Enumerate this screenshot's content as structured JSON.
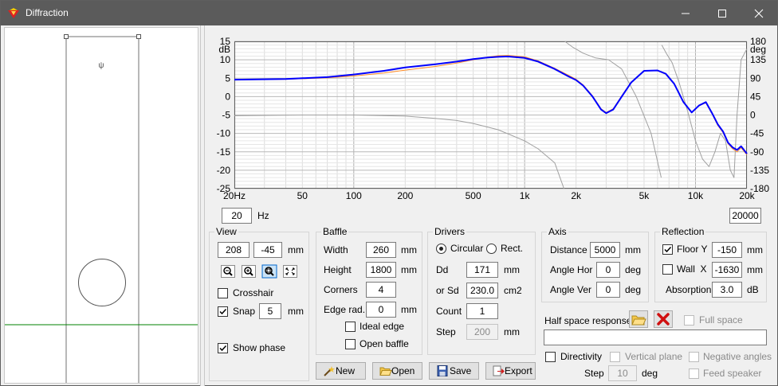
{
  "window": {
    "title": "Diffraction"
  },
  "chart_data": {
    "type": "line",
    "xscale": "log",
    "xlim": [
      20,
      20000
    ],
    "ylim_left": [
      -25,
      15
    ],
    "ylim_right": [
      -180,
      180
    ],
    "yunit_left": "dB",
    "yunit_right": "deg",
    "x_ticks": [
      {
        "v": 20,
        "label": "20Hz"
      },
      {
        "v": 50,
        "label": "50"
      },
      {
        "v": 100,
        "label": "100"
      },
      {
        "v": 200,
        "label": "200"
      },
      {
        "v": 500,
        "label": "500"
      },
      {
        "v": 1000,
        "label": "1k"
      },
      {
        "v": 2000,
        "label": "2k"
      },
      {
        "v": 5000,
        "label": "5k"
      },
      {
        "v": 10000,
        "label": "10k"
      },
      {
        "v": 20000,
        "label": "20k"
      }
    ],
    "y_ticks_left": [
      "15",
      "10",
      "5",
      "0",
      "-5",
      "-10",
      "-15",
      "-20",
      "-25"
    ],
    "y_ticks_right": [
      "180",
      "135",
      "90",
      "45",
      "0",
      "-45",
      "-90",
      "-135",
      "-180"
    ],
    "grid": true,
    "series": [
      {
        "color": "#0000ff",
        "width": 2,
        "x": [
          20,
          40,
          70,
          100,
          150,
          200,
          300,
          400,
          500,
          600,
          700,
          800,
          1000,
          1200,
          1500,
          1800,
          2000,
          2200,
          2500,
          2800,
          3000,
          3300,
          3700,
          4200,
          5000,
          6000,
          6700,
          7500,
          8500,
          9500,
          10500,
          11500,
          12500,
          13500,
          14500,
          15500,
          16500,
          17500,
          18500,
          20000
        ],
        "y": [
          4.6,
          4.8,
          5.3,
          6.0,
          7.0,
          7.9,
          8.8,
          9.5,
          10.2,
          10.6,
          10.8,
          10.9,
          10.5,
          9.5,
          7.5,
          5.5,
          4.5,
          3.0,
          0,
          -3.5,
          -4.5,
          -3.5,
          0,
          3.8,
          7.0,
          7.1,
          6.2,
          3.5,
          -1.5,
          -4.3,
          -2.4,
          -1.5,
          -4.5,
          -7.5,
          -9.5,
          -12.5,
          -13.8,
          -14.5,
          -13.5,
          -15.5
        ]
      },
      {
        "color": "#ff8c28",
        "width": 1,
        "x": [
          20,
          40,
          70,
          100,
          150,
          200,
          300,
          400,
          500,
          600,
          700,
          800,
          1000,
          1200,
          1500,
          1800,
          2000,
          2200,
          2500,
          2800,
          3000,
          3300,
          3700,
          4200,
          5000,
          6000,
          6700,
          7500,
          8500,
          9500,
          10500,
          11500,
          12500,
          13500,
          14500,
          15500,
          16500,
          17500,
          18500,
          20000
        ],
        "y": [
          4.6,
          4.7,
          5.1,
          5.6,
          6.4,
          7.2,
          8.2,
          9.1,
          10.0,
          10.7,
          11.1,
          11.2,
          10.8,
          9.7,
          7.7,
          5.8,
          4.7,
          3.2,
          0.2,
          -3.3,
          -4.3,
          -3.3,
          0.2,
          3.9,
          7.0,
          7.0,
          6.1,
          3.4,
          -1.6,
          -4.3,
          -2.5,
          -1.7,
          -4.7,
          -7.8,
          -9.8,
          -12.8,
          -14.2,
          -15.0,
          -13.9,
          -15.8
        ]
      },
      {
        "color": "#a0a0a0",
        "width": 1,
        "x": [
          20,
          50,
          100,
          200,
          300,
          400,
          500,
          700,
          1000,
          1200,
          1500,
          1700
        ],
        "y": [
          -5.2,
          -5.0,
          -5.0,
          -5.3,
          -5.9,
          -6.5,
          -7.3,
          -9.0,
          -12.0,
          -14.2,
          -18.0,
          -25
        ]
      },
      {
        "color": "#a0a0a0",
        "width": 1,
        "x": [
          1720,
          1900,
          2200,
          2600,
          3100,
          3700,
          4500,
          5500,
          6300
        ],
        "y": [
          15,
          13.5,
          11.8,
          10.5,
          10.0,
          7.5,
          0,
          -10,
          -22
        ]
      },
      {
        "color": "#a0a0a0",
        "width": 1,
        "x": [
          6350,
          6800,
          7300,
          8000,
          9000,
          10000,
          11000,
          12000,
          13000,
          14000,
          15000,
          16000,
          16800,
          17500,
          18500,
          20000
        ],
        "y": [
          14,
          11.5,
          9.2,
          4,
          -4,
          -12,
          -17,
          -19,
          -15,
          -10,
          -12,
          -20,
          -22,
          -5,
          10,
          13
        ]
      }
    ]
  },
  "freq_range": {
    "min": "20",
    "max": "20000",
    "unit": "Hz"
  },
  "view": {
    "title": "View",
    "x": "208",
    "y": "-45",
    "unit": "mm",
    "crosshair_label": "Crosshair",
    "crosshair": false,
    "snap_label": "Snap",
    "snap": true,
    "snap_value": "5",
    "snap_unit": "mm",
    "show_phase_label": "Show phase",
    "show_phase": true
  },
  "baffle": {
    "title": "Baffle",
    "width_label": "Width",
    "width": "260",
    "width_unit": "mm",
    "height_label": "Height",
    "height": "1800",
    "height_unit": "mm",
    "corners_label": "Corners",
    "corners": "4",
    "edge_label": "Edge rad.",
    "edge": "0",
    "edge_unit": "mm",
    "ideal_edge_label": "Ideal edge",
    "ideal_edge": false,
    "open_baffle_label": "Open baffle",
    "open_baffle": false
  },
  "drivers": {
    "title": "Drivers",
    "circular_label": "Circular",
    "rect_label": "Rect.",
    "shape": "circular",
    "dd_label": "Dd",
    "dd": "171",
    "dd_unit": "mm",
    "sd_label": "or Sd",
    "sd": "230.0",
    "sd_unit": "cm2",
    "count_label": "Count",
    "count": "1",
    "step_label": "Step",
    "step": "200",
    "step_unit": "mm"
  },
  "axis": {
    "title": "Axis",
    "distance_label": "Distance",
    "distance": "5000",
    "distance_unit": "mm",
    "hor_label": "Angle Hor",
    "hor": "0",
    "hor_unit": "deg",
    "ver_label": "Angle Ver",
    "ver": "0",
    "ver_unit": "deg"
  },
  "reflection": {
    "title": "Reflection",
    "floor_label": "Floor Y",
    "floor": true,
    "floor_value": "-150",
    "floor_unit": "mm",
    "wall_label": "Wall  X",
    "wall": false,
    "wall_value": "-1630",
    "wall_unit": "mm",
    "absorption_label": "Absorption",
    "absorption": "3.0",
    "absorption_unit": "dB"
  },
  "half_space": {
    "label": "Half space response",
    "full_space_label": "Full space",
    "full_space": false,
    "path": ""
  },
  "directivity": {
    "label": "Directivity",
    "enabled": false,
    "vertical_label": "Vertical plane",
    "negative_label": "Negative angles",
    "feed_label": "Feed speaker",
    "step_label": "Step",
    "step": "10",
    "step_unit": "deg"
  },
  "buttons": {
    "new": "New",
    "open": "Open",
    "save": "Save",
    "export": "Export"
  },
  "baffle_view": {
    "driver_glyph": "ψ"
  },
  "colors": {
    "titlebar": "#5b5b5b",
    "response": "#0000ff",
    "reference": "#ff8c28",
    "floor_line": "#008000",
    "delete": "#d01010"
  }
}
